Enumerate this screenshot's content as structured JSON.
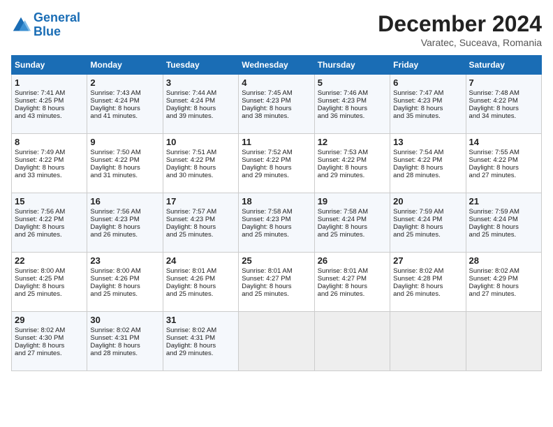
{
  "logo": {
    "line1": "General",
    "line2": "Blue"
  },
  "title": "December 2024",
  "subtitle": "Varatec, Suceava, Romania",
  "headers": [
    "Sunday",
    "Monday",
    "Tuesday",
    "Wednesday",
    "Thursday",
    "Friday",
    "Saturday"
  ],
  "weeks": [
    [
      {
        "day": "1",
        "lines": [
          "Sunrise: 7:41 AM",
          "Sunset: 4:25 PM",
          "Daylight: 8 hours",
          "and 43 minutes."
        ]
      },
      {
        "day": "2",
        "lines": [
          "Sunrise: 7:43 AM",
          "Sunset: 4:24 PM",
          "Daylight: 8 hours",
          "and 41 minutes."
        ]
      },
      {
        "day": "3",
        "lines": [
          "Sunrise: 7:44 AM",
          "Sunset: 4:24 PM",
          "Daylight: 8 hours",
          "and 39 minutes."
        ]
      },
      {
        "day": "4",
        "lines": [
          "Sunrise: 7:45 AM",
          "Sunset: 4:23 PM",
          "Daylight: 8 hours",
          "and 38 minutes."
        ]
      },
      {
        "day": "5",
        "lines": [
          "Sunrise: 7:46 AM",
          "Sunset: 4:23 PM",
          "Daylight: 8 hours",
          "and 36 minutes."
        ]
      },
      {
        "day": "6",
        "lines": [
          "Sunrise: 7:47 AM",
          "Sunset: 4:23 PM",
          "Daylight: 8 hours",
          "and 35 minutes."
        ]
      },
      {
        "day": "7",
        "lines": [
          "Sunrise: 7:48 AM",
          "Sunset: 4:22 PM",
          "Daylight: 8 hours",
          "and 34 minutes."
        ]
      }
    ],
    [
      {
        "day": "8",
        "lines": [
          "Sunrise: 7:49 AM",
          "Sunset: 4:22 PM",
          "Daylight: 8 hours",
          "and 33 minutes."
        ]
      },
      {
        "day": "9",
        "lines": [
          "Sunrise: 7:50 AM",
          "Sunset: 4:22 PM",
          "Daylight: 8 hours",
          "and 31 minutes."
        ]
      },
      {
        "day": "10",
        "lines": [
          "Sunrise: 7:51 AM",
          "Sunset: 4:22 PM",
          "Daylight: 8 hours",
          "and 30 minutes."
        ]
      },
      {
        "day": "11",
        "lines": [
          "Sunrise: 7:52 AM",
          "Sunset: 4:22 PM",
          "Daylight: 8 hours",
          "and 29 minutes."
        ]
      },
      {
        "day": "12",
        "lines": [
          "Sunrise: 7:53 AM",
          "Sunset: 4:22 PM",
          "Daylight: 8 hours",
          "and 29 minutes."
        ]
      },
      {
        "day": "13",
        "lines": [
          "Sunrise: 7:54 AM",
          "Sunset: 4:22 PM",
          "Daylight: 8 hours",
          "and 28 minutes."
        ]
      },
      {
        "day": "14",
        "lines": [
          "Sunrise: 7:55 AM",
          "Sunset: 4:22 PM",
          "Daylight: 8 hours",
          "and 27 minutes."
        ]
      }
    ],
    [
      {
        "day": "15",
        "lines": [
          "Sunrise: 7:56 AM",
          "Sunset: 4:22 PM",
          "Daylight: 8 hours",
          "and 26 minutes."
        ]
      },
      {
        "day": "16",
        "lines": [
          "Sunrise: 7:56 AM",
          "Sunset: 4:23 PM",
          "Daylight: 8 hours",
          "and 26 minutes."
        ]
      },
      {
        "day": "17",
        "lines": [
          "Sunrise: 7:57 AM",
          "Sunset: 4:23 PM",
          "Daylight: 8 hours",
          "and 25 minutes."
        ]
      },
      {
        "day": "18",
        "lines": [
          "Sunrise: 7:58 AM",
          "Sunset: 4:23 PM",
          "Daylight: 8 hours",
          "and 25 minutes."
        ]
      },
      {
        "day": "19",
        "lines": [
          "Sunrise: 7:58 AM",
          "Sunset: 4:24 PM",
          "Daylight: 8 hours",
          "and 25 minutes."
        ]
      },
      {
        "day": "20",
        "lines": [
          "Sunrise: 7:59 AM",
          "Sunset: 4:24 PM",
          "Daylight: 8 hours",
          "and 25 minutes."
        ]
      },
      {
        "day": "21",
        "lines": [
          "Sunrise: 7:59 AM",
          "Sunset: 4:24 PM",
          "Daylight: 8 hours",
          "and 25 minutes."
        ]
      }
    ],
    [
      {
        "day": "22",
        "lines": [
          "Sunrise: 8:00 AM",
          "Sunset: 4:25 PM",
          "Daylight: 8 hours",
          "and 25 minutes."
        ]
      },
      {
        "day": "23",
        "lines": [
          "Sunrise: 8:00 AM",
          "Sunset: 4:26 PM",
          "Daylight: 8 hours",
          "and 25 minutes."
        ]
      },
      {
        "day": "24",
        "lines": [
          "Sunrise: 8:01 AM",
          "Sunset: 4:26 PM",
          "Daylight: 8 hours",
          "and 25 minutes."
        ]
      },
      {
        "day": "25",
        "lines": [
          "Sunrise: 8:01 AM",
          "Sunset: 4:27 PM",
          "Daylight: 8 hours",
          "and 25 minutes."
        ]
      },
      {
        "day": "26",
        "lines": [
          "Sunrise: 8:01 AM",
          "Sunset: 4:27 PM",
          "Daylight: 8 hours",
          "and 26 minutes."
        ]
      },
      {
        "day": "27",
        "lines": [
          "Sunrise: 8:02 AM",
          "Sunset: 4:28 PM",
          "Daylight: 8 hours",
          "and 26 minutes."
        ]
      },
      {
        "day": "28",
        "lines": [
          "Sunrise: 8:02 AM",
          "Sunset: 4:29 PM",
          "Daylight: 8 hours",
          "and 27 minutes."
        ]
      }
    ],
    [
      {
        "day": "29",
        "lines": [
          "Sunrise: 8:02 AM",
          "Sunset: 4:30 PM",
          "Daylight: 8 hours",
          "and 27 minutes."
        ]
      },
      {
        "day": "30",
        "lines": [
          "Sunrise: 8:02 AM",
          "Sunset: 4:31 PM",
          "Daylight: 8 hours",
          "and 28 minutes."
        ]
      },
      {
        "day": "31",
        "lines": [
          "Sunrise: 8:02 AM",
          "Sunset: 4:31 PM",
          "Daylight: 8 hours",
          "and 29 minutes."
        ]
      },
      {
        "day": "",
        "lines": []
      },
      {
        "day": "",
        "lines": []
      },
      {
        "day": "",
        "lines": []
      },
      {
        "day": "",
        "lines": []
      }
    ]
  ]
}
